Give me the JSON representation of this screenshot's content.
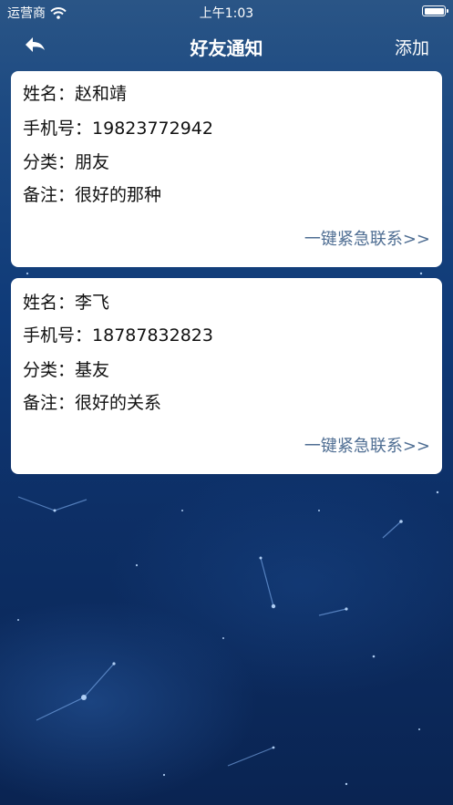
{
  "status_bar": {
    "carrier": "运营商",
    "time": "上午1:03"
  },
  "nav": {
    "title": "好友通知",
    "add_label": "添加"
  },
  "labels": {
    "name": "姓名：",
    "phone": "手机号：",
    "category": "分类：",
    "note": "备注：",
    "emergency": "一键紧急联系>>"
  },
  "contacts": [
    {
      "name": "赵和靖",
      "phone": "19823772942",
      "category": "朋友",
      "note": "很好的那种"
    },
    {
      "name": "李飞",
      "phone": "18787832823",
      "category": "基友",
      "note": "很好的关系"
    }
  ],
  "colors": {
    "accent": "#4f6e93",
    "card": "#ffffff",
    "header": "#2a5586",
    "background": "#0b2a5e"
  }
}
